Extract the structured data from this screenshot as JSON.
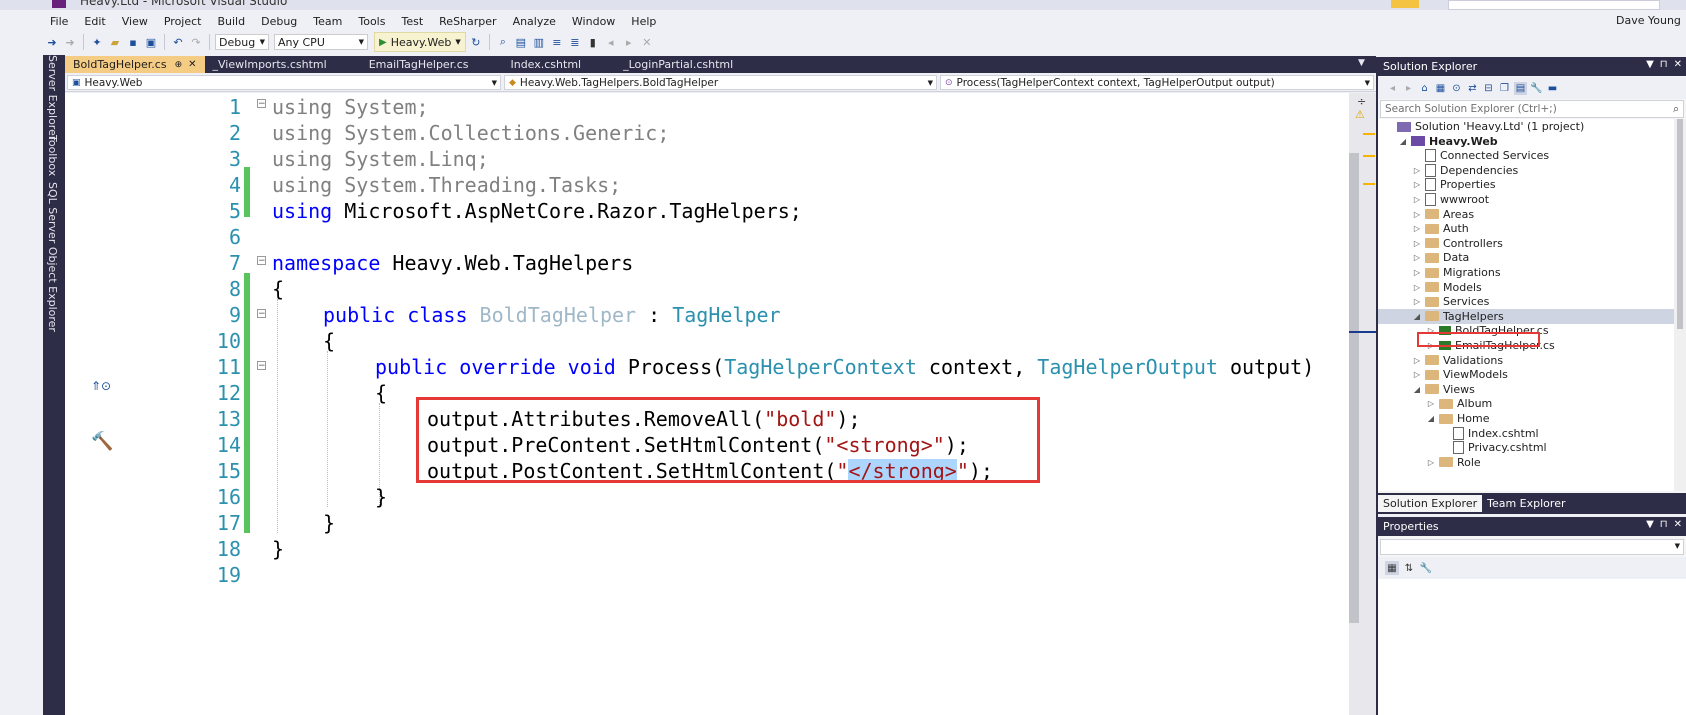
{
  "window": {
    "title": "Heavy.Ltd - Microsoft Visual Studio",
    "user": "Dave Young"
  },
  "menu": [
    "File",
    "Edit",
    "View",
    "Project",
    "Build",
    "Debug",
    "Team",
    "Tools",
    "Test",
    "ReSharper",
    "Analyze",
    "Window",
    "Help"
  ],
  "toolbar": {
    "config": "Debug",
    "platform": "Any CPU",
    "start": "Heavy.Web"
  },
  "left_rail": [
    "Server Explorer",
    "Toolbox",
    "SQL Server Object Explorer"
  ],
  "tabs": [
    {
      "label": "BoldTagHelper.cs",
      "active": true
    },
    {
      "label": "_ViewImports.cshtml"
    },
    {
      "label": "EmailTagHelper.cs"
    },
    {
      "label": "Index.cshtml"
    },
    {
      "label": "_LoginPartial.cshtml"
    }
  ],
  "navbar": {
    "project": "Heavy.Web",
    "type": "Heavy.Web.TagHelpers.BoldTagHelper",
    "member": "Process(TagHelperContext context, TagHelperOutput output)"
  },
  "code": {
    "line_numbers": [
      "1",
      "2",
      "3",
      "4",
      "5",
      "6",
      "7",
      "8",
      "9",
      "10",
      "11",
      "12",
      "13",
      "14",
      "15",
      "16",
      "17",
      "18",
      "19"
    ],
    "l1": "using System;",
    "l2": "using System.Collections.Generic;",
    "l3": "using System.Linq;",
    "l4": "using System.Threading.Tasks;",
    "l5_kw": "using",
    "l5_rest": " Microsoft.AspNetCore.Razor.TagHelpers;",
    "l7_kw": "namespace",
    "l7_rest": " Heavy.Web.TagHelpers",
    "open_brace": "{",
    "close_brace": "}",
    "l9_kw": "public class",
    "l9_name": "BoldTagHelper",
    "l9_colon": " : ",
    "l9_base": "TagHelper",
    "l11_kw": "public override void",
    "l11_method": " Process(",
    "l11_t1": "TagHelperContext",
    "l11_p1": " context, ",
    "l11_t2": "TagHelperOutput",
    "l11_p2": " output)",
    "l13_a": "output.Attributes.RemoveAll(",
    "l13_s": "\"bold\"",
    "l13_b": ");",
    "l14_a": "output.PreContent.SetHtmlContent(",
    "l14_s": "\"<strong>\"",
    "l14_b": ");",
    "l15_a": "output.PostContent.SetHtmlContent(",
    "l15_q1": "\"",
    "l15_sel": "</strong>",
    "l15_q2": "\"",
    "l15_b": ");"
  },
  "solution_explorer": {
    "title": "Solution Explorer",
    "search_placeholder": "Search Solution Explorer (Ctrl+;)",
    "tree": [
      {
        "label": "Solution 'Heavy.Ltd' (1 project)",
        "depth": 0,
        "icon": "solution-icon",
        "expander": ""
      },
      {
        "label": "Heavy.Web",
        "depth": 1,
        "icon": "project-icon",
        "expander": "◢",
        "bold": true
      },
      {
        "label": "Connected Services",
        "depth": 2,
        "icon": "cloud-icon",
        "expander": ""
      },
      {
        "label": "Dependencies",
        "depth": 2,
        "icon": "dependencies-icon",
        "expander": "▷"
      },
      {
        "label": "Properties",
        "depth": 2,
        "icon": "wrench-icon",
        "expander": "▷"
      },
      {
        "label": "wwwroot",
        "depth": 2,
        "icon": "globe-icon",
        "expander": "▷"
      },
      {
        "label": "Areas",
        "depth": 2,
        "icon": "folder-icon",
        "expander": "▷"
      },
      {
        "label": "Auth",
        "depth": 2,
        "icon": "folder-icon",
        "expander": "▷"
      },
      {
        "label": "Controllers",
        "depth": 2,
        "icon": "folder-icon",
        "expander": "▷"
      },
      {
        "label": "Data",
        "depth": 2,
        "icon": "folder-icon",
        "expander": "▷"
      },
      {
        "label": "Migrations",
        "depth": 2,
        "icon": "folder-icon",
        "expander": "▷"
      },
      {
        "label": "Models",
        "depth": 2,
        "icon": "folder-icon",
        "expander": "▷"
      },
      {
        "label": "Services",
        "depth": 2,
        "icon": "folder-icon",
        "expander": "▷"
      },
      {
        "label": "TagHelpers",
        "depth": 2,
        "icon": "folder-open-icon",
        "expander": "◢",
        "selected": true
      },
      {
        "label": "BoldTagHelper.cs",
        "depth": 3,
        "icon": "csharp-file-icon",
        "expander": "▷"
      },
      {
        "label": "EmailTagHelper.cs",
        "depth": 3,
        "icon": "csharp-file-icon",
        "expander": "▷"
      },
      {
        "label": "Validations",
        "depth": 2,
        "icon": "folder-icon",
        "expander": "▷"
      },
      {
        "label": "ViewModels",
        "depth": 2,
        "icon": "folder-icon",
        "expander": "▷"
      },
      {
        "label": "Views",
        "depth": 2,
        "icon": "folder-open-icon",
        "expander": "◢"
      },
      {
        "label": "Album",
        "depth": 3,
        "icon": "folder-icon",
        "expander": "▷"
      },
      {
        "label": "Home",
        "depth": 3,
        "icon": "folder-open-icon",
        "expander": "◢"
      },
      {
        "label": "Index.cshtml",
        "depth": 4,
        "icon": "file-icon",
        "expander": ""
      },
      {
        "label": "Privacy.cshtml",
        "depth": 4,
        "icon": "file-icon",
        "expander": ""
      },
      {
        "label": "Role",
        "depth": 3,
        "icon": "folder-icon",
        "expander": "▷"
      }
    ],
    "tabs": [
      "Solution Explorer",
      "Team Explorer"
    ]
  },
  "properties": {
    "title": "Properties"
  }
}
